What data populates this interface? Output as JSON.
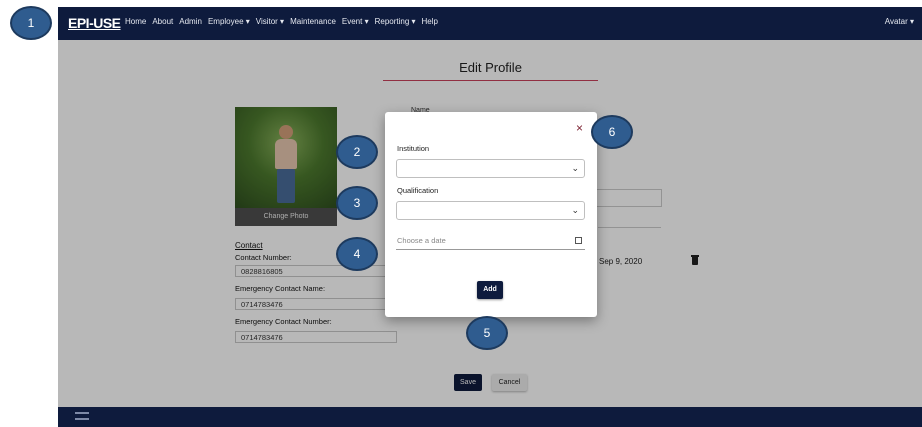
{
  "nav": {
    "logo": "EPI-USE",
    "items": [
      "Home",
      "About",
      "Admin",
      "Employee ▾",
      "Visitor ▾",
      "Maintenance",
      "Event ▾",
      "Reporting ▾",
      "Help"
    ],
    "avatar": "Avatar ▾"
  },
  "page": {
    "title": "Edit Profile",
    "change_photo": "Change Photo",
    "name_label": "Name",
    "contact_heading": "Contact",
    "contact_number_label": "Contact Number:",
    "contact_number": "0828816805",
    "emergency_name_label": "Emergency Contact Name:",
    "emergency_name": "0714783476",
    "emergency_number_label": "Emergency Contact Number:",
    "emergency_number": "0714783476",
    "bg_date": "Sep 9, 2020",
    "save_label": "Save",
    "cancel_label": "Cancel"
  },
  "modal": {
    "close": "×",
    "institution_label": "Institution",
    "institution_value": "",
    "qualification_label": "Qualification",
    "qualification_value": "",
    "date_placeholder": "Choose a date",
    "add_label": "Add"
  },
  "callouts": [
    "1",
    "2",
    "3",
    "4",
    "5",
    "6"
  ]
}
